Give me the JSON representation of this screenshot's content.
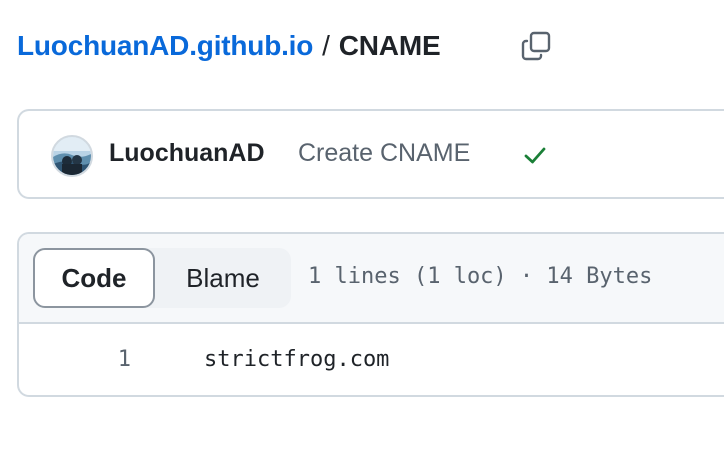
{
  "breadcrumb": {
    "repo": "LuochuanAD.github.io",
    "separator": "/",
    "file": "CNAME"
  },
  "icons": {
    "copy": "copy-icon",
    "check": "check-icon",
    "avatar": "avatar"
  },
  "commit": {
    "author": "LuochuanAD",
    "message": "Create CNAME",
    "status_color": "#1a7f37"
  },
  "file": {
    "tabs": [
      {
        "label": "Code",
        "selected": true
      },
      {
        "label": "Blame",
        "selected": false
      }
    ],
    "stats": "1 lines (1 loc) · 14 Bytes",
    "lines": [
      {
        "number": "1",
        "text": "strictfrog.com"
      }
    ]
  },
  "colors": {
    "link": "#0969da",
    "border": "#d1d9e0",
    "muted": "#59636e"
  }
}
